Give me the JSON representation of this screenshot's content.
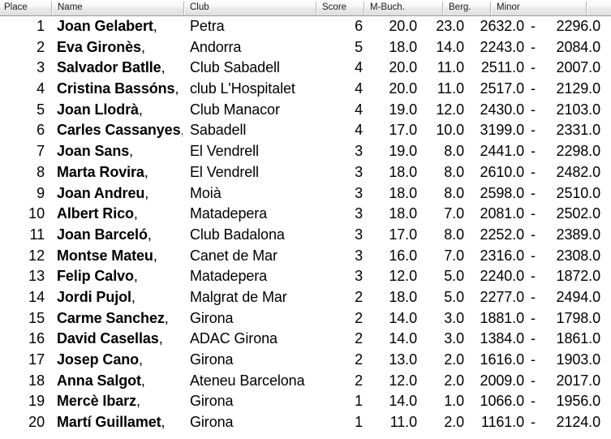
{
  "table": {
    "columns": [
      {
        "key": "place",
        "label": "Place"
      },
      {
        "key": "name",
        "label": "Name"
      },
      {
        "key": "club",
        "label": "Club"
      },
      {
        "key": "score",
        "label": "Score"
      },
      {
        "key": "mbuch",
        "label": "M-Buch."
      },
      {
        "key": "berg",
        "label": "Berg."
      },
      {
        "key": "minor",
        "label": "Minor"
      }
    ],
    "minor_separator": "-",
    "rows": [
      {
        "place": "1",
        "name": "Joan Gelabert",
        "club": "Petra",
        "score": "6",
        "mbuch": "20.0",
        "berg": "23.0",
        "minor1": "2632.0",
        "minor2": "2296.0"
      },
      {
        "place": "2",
        "name": "Eva Gironès",
        "club": "Andorra",
        "score": "5",
        "mbuch": "18.0",
        "berg": "14.0",
        "minor1": "2243.0",
        "minor2": "2084.0"
      },
      {
        "place": "3",
        "name": "Salvador Batlle",
        "club": "Club Sabadell",
        "score": "4",
        "mbuch": "20.0",
        "berg": "11.0",
        "minor1": "2511.0",
        "minor2": "2007.0"
      },
      {
        "place": "4",
        "name": "Cristina Bassóns",
        "club": "club L'Hospitalet",
        "score": "4",
        "mbuch": "20.0",
        "berg": "11.0",
        "minor1": "2517.0",
        "minor2": "2129.0"
      },
      {
        "place": "5",
        "name": "Joan Llodrà",
        "club": "Club Manacor",
        "score": "4",
        "mbuch": "19.0",
        "berg": "12.0",
        "minor1": "2430.0",
        "minor2": "2103.0"
      },
      {
        "place": "6",
        "name": "Carles Cassanyes",
        "club": "Sabadell",
        "score": "4",
        "mbuch": "17.0",
        "berg": "10.0",
        "minor1": "3199.0",
        "minor2": "2331.0"
      },
      {
        "place": "7",
        "name": "Joan Sans",
        "club": "El Vendrell",
        "score": "3",
        "mbuch": "19.0",
        "berg": "8.0",
        "minor1": "2441.0",
        "minor2": "2298.0"
      },
      {
        "place": "8",
        "name": "Marta Rovira",
        "club": "El Vendrell",
        "score": "3",
        "mbuch": "18.0",
        "berg": "8.0",
        "minor1": "2610.0",
        "minor2": "2482.0"
      },
      {
        "place": "9",
        "name": "Joan Andreu",
        "club": "Moià",
        "score": "3",
        "mbuch": "18.0",
        "berg": "8.0",
        "minor1": "2598.0",
        "minor2": "2510.0"
      },
      {
        "place": "10",
        "name": "Albert Rico",
        "club": "Matadepera",
        "score": "3",
        "mbuch": "18.0",
        "berg": "7.0",
        "minor1": "2081.0",
        "minor2": "2502.0"
      },
      {
        "place": "11",
        "name": "Joan Barceló",
        "club": "Club Badalona",
        "score": "3",
        "mbuch": "17.0",
        "berg": "8.0",
        "minor1": "2252.0",
        "minor2": "2389.0"
      },
      {
        "place": "12",
        "name": "Montse Mateu",
        "club": "Canet de Mar",
        "score": "3",
        "mbuch": "16.0",
        "berg": "7.0",
        "minor1": "2316.0",
        "minor2": "2308.0"
      },
      {
        "place": "13",
        "name": "Felip Calvo",
        "club": "Matadepera",
        "score": "3",
        "mbuch": "12.0",
        "berg": "5.0",
        "minor1": "2240.0",
        "minor2": "1872.0"
      },
      {
        "place": "14",
        "name": "Jordi Pujol",
        "club": "Malgrat de Mar",
        "score": "2",
        "mbuch": "18.0",
        "berg": "5.0",
        "minor1": "2277.0",
        "minor2": "2494.0"
      },
      {
        "place": "15",
        "name": "Carme Sanchez",
        "club": "Girona",
        "score": "2",
        "mbuch": "14.0",
        "berg": "3.0",
        "minor1": "1881.0",
        "minor2": "1798.0"
      },
      {
        "place": "16",
        "name": "David Casellas",
        "club": "ADAC Girona",
        "score": "2",
        "mbuch": "14.0",
        "berg": "3.0",
        "minor1": "1384.0",
        "minor2": "1861.0"
      },
      {
        "place": "17",
        "name": "Josep Cano",
        "club": "Girona",
        "score": "2",
        "mbuch": "13.0",
        "berg": "2.0",
        "minor1": "1616.0",
        "minor2": "1903.0"
      },
      {
        "place": "18",
        "name": "Anna Salgot",
        "club": "Ateneu Barcelona",
        "score": "2",
        "mbuch": "12.0",
        "berg": "2.0",
        "minor1": "2009.0",
        "minor2": "2017.0"
      },
      {
        "place": "19",
        "name": "Mercè Ibarz",
        "club": "Girona",
        "score": "1",
        "mbuch": "14.0",
        "berg": "1.0",
        "minor1": "1066.0",
        "minor2": "1956.0"
      },
      {
        "place": "20",
        "name": "Martí Guillamet",
        "club": "Girona",
        "score": "1",
        "mbuch": "11.0",
        "berg": "2.0",
        "minor1": "1161.0",
        "minor2": "2124.0"
      }
    ]
  }
}
